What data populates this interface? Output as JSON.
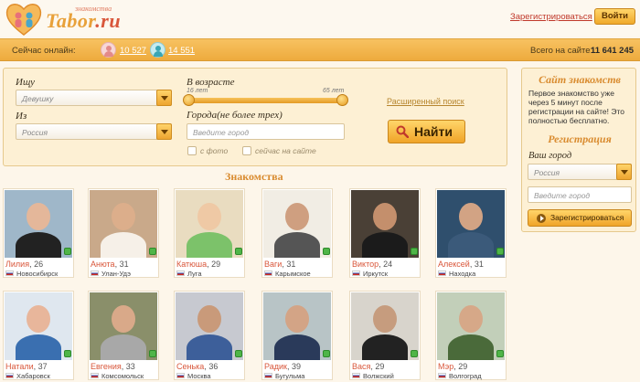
{
  "header": {
    "logo_tagline": "знакомства",
    "logo_name": "Tabor",
    "logo_tld": ".ru",
    "register_link": "Зарегистрироваться",
    "login_button": "Войти"
  },
  "online_bar": {
    "label": "Сейчас онлайн:",
    "women_count": "10 527",
    "men_count": "14 551",
    "total_label": "Всего на сайте:",
    "total_value": "11 641 245"
  },
  "search": {
    "seek_label": "Ищу",
    "seek_value": "Девушку",
    "from_label": "Из",
    "from_value": "Россия",
    "age_label": "В возрасте",
    "age_min": "16 лет",
    "age_max": "65 лет",
    "age_range_min_fraction": 0.0,
    "age_range_max_fraction": 1.0,
    "cities_label": "Города(не более трех)",
    "city_placeholder": "Введите город",
    "with_photo_label": "с фото",
    "online_now_label": "сейчас на сайте",
    "advanced_link": "Расширенный поиск",
    "find_button": "Найти"
  },
  "section_title": "Знакомства",
  "profiles": [
    {
      "name": "Лилия",
      "age": ", 26",
      "city": "Новосибирск",
      "online": true
    },
    {
      "name": "Анюта",
      "age": ", 31",
      "city": "Улан-Удэ",
      "online": true
    },
    {
      "name": "Катюша",
      "age": ", 29",
      "city": "Луга",
      "online": true
    },
    {
      "name": "Ваги",
      "age": ", 31",
      "city": "Карымское",
      "online": true
    },
    {
      "name": "Виктор",
      "age": ", 24",
      "city": "Иркутск",
      "online": true
    },
    {
      "name": "Алексей",
      "age": ", 31",
      "city": "Находка",
      "online": true
    },
    {
      "name": "Натали",
      "age": ", 37",
      "city": "Хабаровск",
      "online": true
    },
    {
      "name": "Евгения",
      "age": ", 33",
      "city": "Комсомольск",
      "online": true
    },
    {
      "name": "Сенька",
      "age": ", 36",
      "city": "Москва",
      "online": true
    },
    {
      "name": "Радик",
      "age": ", 39",
      "city": "Бугульма",
      "online": true
    },
    {
      "name": "Вася",
      "age": ", 29",
      "city": "Волжский",
      "online": true
    },
    {
      "name": "Мэр",
      "age": ", 29",
      "city": "Волгоград",
      "online": true
    }
  ],
  "right_panel": {
    "title": "Сайт знакомств",
    "text": "Первое знакомство уже через 5 минут после регистрации на сайте! Это полностью бесплатно.",
    "reg_title": "Регистрация",
    "city_label": "Ваш город",
    "country_value": "Россия",
    "city_placeholder": "Введите город",
    "register_button": "Зарегистрироваться"
  },
  "colors": {
    "accent_orange": "#f0a428",
    "name_red": "#d9573b",
    "online_green": "#4fb548"
  }
}
